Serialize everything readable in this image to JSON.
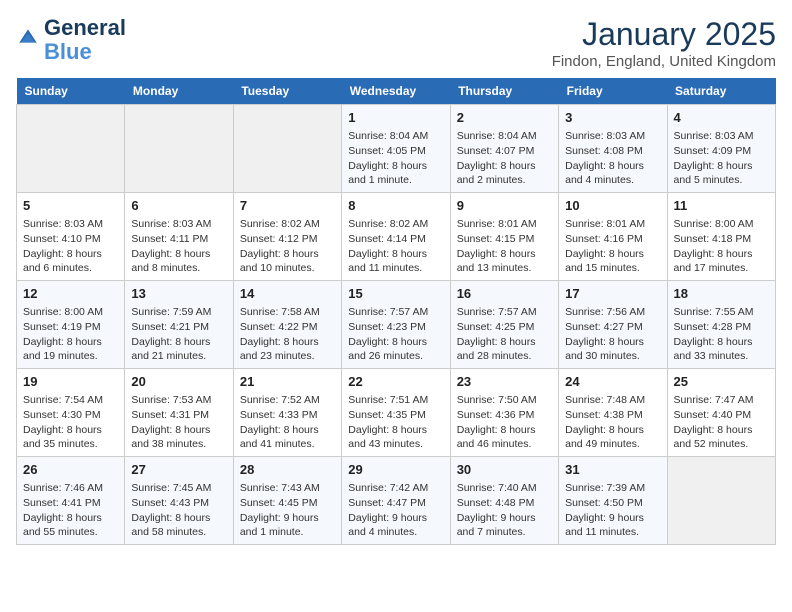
{
  "header": {
    "logo_line1": "General",
    "logo_line2": "Blue",
    "month": "January 2025",
    "location": "Findon, England, United Kingdom"
  },
  "weekdays": [
    "Sunday",
    "Monday",
    "Tuesday",
    "Wednesday",
    "Thursday",
    "Friday",
    "Saturday"
  ],
  "weeks": [
    [
      {
        "day": "",
        "content": ""
      },
      {
        "day": "",
        "content": ""
      },
      {
        "day": "",
        "content": ""
      },
      {
        "day": "1",
        "content": "Sunrise: 8:04 AM\nSunset: 4:05 PM\nDaylight: 8 hours and 1 minute."
      },
      {
        "day": "2",
        "content": "Sunrise: 8:04 AM\nSunset: 4:07 PM\nDaylight: 8 hours and 2 minutes."
      },
      {
        "day": "3",
        "content": "Sunrise: 8:03 AM\nSunset: 4:08 PM\nDaylight: 8 hours and 4 minutes."
      },
      {
        "day": "4",
        "content": "Sunrise: 8:03 AM\nSunset: 4:09 PM\nDaylight: 8 hours and 5 minutes."
      }
    ],
    [
      {
        "day": "5",
        "content": "Sunrise: 8:03 AM\nSunset: 4:10 PM\nDaylight: 8 hours and 6 minutes."
      },
      {
        "day": "6",
        "content": "Sunrise: 8:03 AM\nSunset: 4:11 PM\nDaylight: 8 hours and 8 minutes."
      },
      {
        "day": "7",
        "content": "Sunrise: 8:02 AM\nSunset: 4:12 PM\nDaylight: 8 hours and 10 minutes."
      },
      {
        "day": "8",
        "content": "Sunrise: 8:02 AM\nSunset: 4:14 PM\nDaylight: 8 hours and 11 minutes."
      },
      {
        "day": "9",
        "content": "Sunrise: 8:01 AM\nSunset: 4:15 PM\nDaylight: 8 hours and 13 minutes."
      },
      {
        "day": "10",
        "content": "Sunrise: 8:01 AM\nSunset: 4:16 PM\nDaylight: 8 hours and 15 minutes."
      },
      {
        "day": "11",
        "content": "Sunrise: 8:00 AM\nSunset: 4:18 PM\nDaylight: 8 hours and 17 minutes."
      }
    ],
    [
      {
        "day": "12",
        "content": "Sunrise: 8:00 AM\nSunset: 4:19 PM\nDaylight: 8 hours and 19 minutes."
      },
      {
        "day": "13",
        "content": "Sunrise: 7:59 AM\nSunset: 4:21 PM\nDaylight: 8 hours and 21 minutes."
      },
      {
        "day": "14",
        "content": "Sunrise: 7:58 AM\nSunset: 4:22 PM\nDaylight: 8 hours and 23 minutes."
      },
      {
        "day": "15",
        "content": "Sunrise: 7:57 AM\nSunset: 4:23 PM\nDaylight: 8 hours and 26 minutes."
      },
      {
        "day": "16",
        "content": "Sunrise: 7:57 AM\nSunset: 4:25 PM\nDaylight: 8 hours and 28 minutes."
      },
      {
        "day": "17",
        "content": "Sunrise: 7:56 AM\nSunset: 4:27 PM\nDaylight: 8 hours and 30 minutes."
      },
      {
        "day": "18",
        "content": "Sunrise: 7:55 AM\nSunset: 4:28 PM\nDaylight: 8 hours and 33 minutes."
      }
    ],
    [
      {
        "day": "19",
        "content": "Sunrise: 7:54 AM\nSunset: 4:30 PM\nDaylight: 8 hours and 35 minutes."
      },
      {
        "day": "20",
        "content": "Sunrise: 7:53 AM\nSunset: 4:31 PM\nDaylight: 8 hours and 38 minutes."
      },
      {
        "day": "21",
        "content": "Sunrise: 7:52 AM\nSunset: 4:33 PM\nDaylight: 8 hours and 41 minutes."
      },
      {
        "day": "22",
        "content": "Sunrise: 7:51 AM\nSunset: 4:35 PM\nDaylight: 8 hours and 43 minutes."
      },
      {
        "day": "23",
        "content": "Sunrise: 7:50 AM\nSunset: 4:36 PM\nDaylight: 8 hours and 46 minutes."
      },
      {
        "day": "24",
        "content": "Sunrise: 7:48 AM\nSunset: 4:38 PM\nDaylight: 8 hours and 49 minutes."
      },
      {
        "day": "25",
        "content": "Sunrise: 7:47 AM\nSunset: 4:40 PM\nDaylight: 8 hours and 52 minutes."
      }
    ],
    [
      {
        "day": "26",
        "content": "Sunrise: 7:46 AM\nSunset: 4:41 PM\nDaylight: 8 hours and 55 minutes."
      },
      {
        "day": "27",
        "content": "Sunrise: 7:45 AM\nSunset: 4:43 PM\nDaylight: 8 hours and 58 minutes."
      },
      {
        "day": "28",
        "content": "Sunrise: 7:43 AM\nSunset: 4:45 PM\nDaylight: 9 hours and 1 minute."
      },
      {
        "day": "29",
        "content": "Sunrise: 7:42 AM\nSunset: 4:47 PM\nDaylight: 9 hours and 4 minutes."
      },
      {
        "day": "30",
        "content": "Sunrise: 7:40 AM\nSunset: 4:48 PM\nDaylight: 9 hours and 7 minutes."
      },
      {
        "day": "31",
        "content": "Sunrise: 7:39 AM\nSunset: 4:50 PM\nDaylight: 9 hours and 11 minutes."
      },
      {
        "day": "",
        "content": ""
      }
    ]
  ]
}
